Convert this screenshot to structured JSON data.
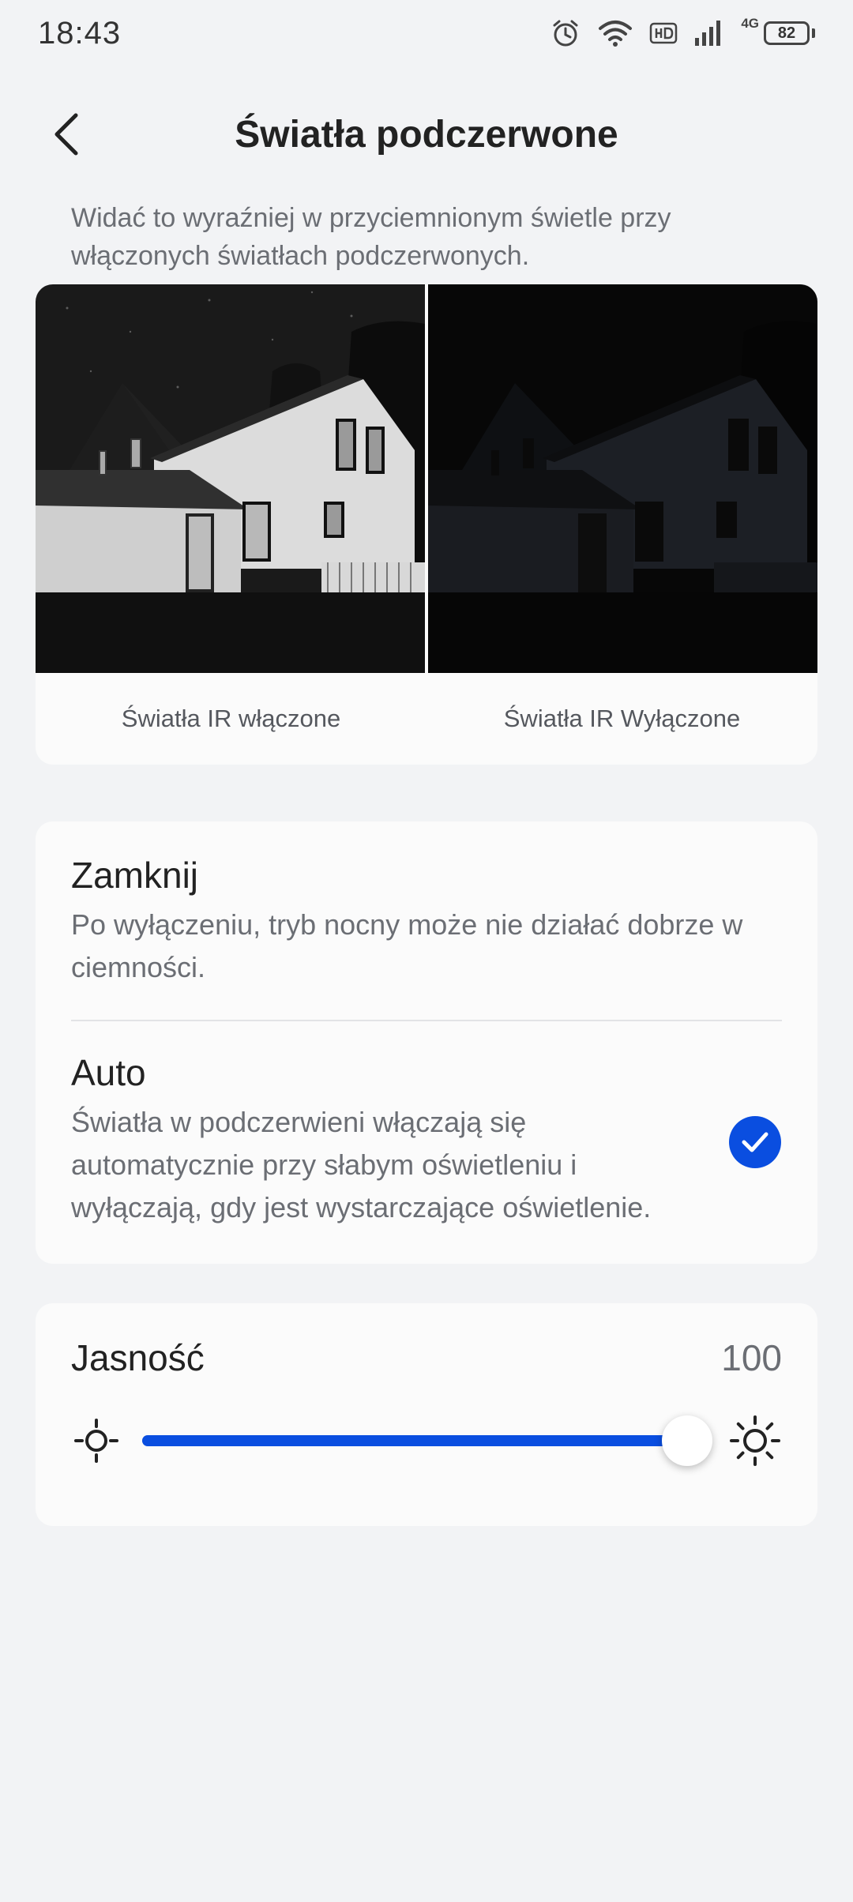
{
  "status_bar": {
    "time": "18:43",
    "network": "4G",
    "battery": "82",
    "icons": [
      "alarm-icon",
      "wifi-icon",
      "hd-icon",
      "signal-icon",
      "battery-icon"
    ]
  },
  "header": {
    "title": "Światła podczerwone",
    "back_icon": "chevron-left-icon"
  },
  "intro": "Widać to wyraźniej w przyciemnionym świetle przy włączonych światłach podczerwonych.",
  "comparison": {
    "on_label": "Światła IR włączone",
    "off_label": "Światła IR Wyłączone"
  },
  "options": [
    {
      "title": "Zamknij",
      "description": "Po wyłączeniu, tryb nocny może nie działać dobrze w ciemności.",
      "selected": false
    },
    {
      "title": "Auto",
      "description": "Światła w podczerwieni włączają się automatycznie przy słabym oświetleniu i wyłączają, gdy jest wystarczające oświetlenie.",
      "selected": true
    }
  ],
  "brightness": {
    "label": "Jasność",
    "value": "100",
    "level_fraction": 1.0
  },
  "colors": {
    "accent": "#0a4ee0",
    "background": "#f2f3f5",
    "card": "#fbfbfb"
  }
}
